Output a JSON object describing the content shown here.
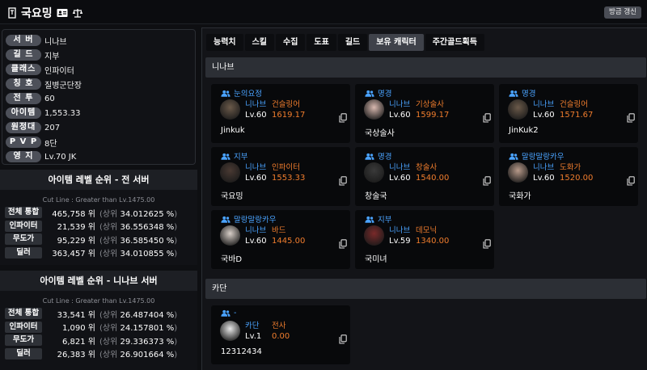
{
  "header": {
    "title": "국요밍",
    "refresh_label": "방금 갱신"
  },
  "info": [
    {
      "label": "서 버",
      "value": "니나브"
    },
    {
      "label": "길 드",
      "value": "지부"
    },
    {
      "label": "클래스",
      "value": "인파이터"
    },
    {
      "label": "칭 호",
      "value": "질병군단장"
    },
    {
      "label": "전 투",
      "value": "60"
    },
    {
      "label": "아이템",
      "value": "1,553.33"
    },
    {
      "label": "원정대",
      "value": "207"
    },
    {
      "label": "P V P",
      "value": "8단"
    },
    {
      "label": "영 지",
      "value": "Lv.70 JK"
    }
  ],
  "rank_all": {
    "title": "아이템 레벨 순위 - 전 서버",
    "cutline": "Cut Line : Greater than Lv.1475.00",
    "rows": [
      {
        "label": "전체 통합",
        "rank": "465,758 위",
        "pct": "34.012625 %"
      },
      {
        "label": "인파이터",
        "rank": "21,539 위",
        "pct": "36.556348 %"
      },
      {
        "label": "무도가",
        "rank": "95,229 위",
        "pct": "36.585450 %"
      },
      {
        "label": "딜러",
        "rank": "363,457 위",
        "pct": "34.010855 %"
      }
    ]
  },
  "rank_server": {
    "title": "아이템 레벨 순위 - 니나브 서버",
    "cutline": "Cut Line : Greater than Lv.1475.00",
    "rows": [
      {
        "label": "전체 통합",
        "rank": "33,541 위",
        "pct": "26.487404 %"
      },
      {
        "label": "인파이터",
        "rank": "1,090 위",
        "pct": "24.157801 %"
      },
      {
        "label": "무도가",
        "rank": "6,821 위",
        "pct": "29.336373 %"
      },
      {
        "label": "딜러",
        "rank": "26,383 위",
        "pct": "26.901664 %"
      }
    ]
  },
  "rank_labels": {
    "upper": "(상위",
    "close": ")"
  },
  "tabs": [
    "능력치",
    "스킬",
    "수집",
    "도표",
    "길드",
    "보유 캐릭터",
    "주간골드획득"
  ],
  "active_tab": "보유 캐릭터",
  "groups": [
    {
      "server": "니나브",
      "characters": [
        {
          "guild": "눈의요정",
          "server": "니나브",
          "class": "건슬링어",
          "level": "Lv.60",
          "ilvl": "1619.17",
          "name": "Jinkuk",
          "avatar_color": "#6b5a4a"
        },
        {
          "guild": "명경",
          "server": "니나브",
          "class": "기상술사",
          "level": "Lv.60",
          "ilvl": "1599.17",
          "name": "국상술사",
          "avatar_color": "#d9b9b0"
        },
        {
          "guild": "명경",
          "server": "니나브",
          "class": "건슬링어",
          "level": "Lv.60",
          "ilvl": "1571.67",
          "name": "JinKuk2",
          "avatar_color": "#6b5a4a"
        },
        {
          "guild": "지부",
          "server": "니나브",
          "class": "인파이터",
          "level": "Lv.60",
          "ilvl": "1553.33",
          "name": "국요밍",
          "avatar_color": "#4a3a33"
        },
        {
          "guild": "명경",
          "server": "니나브",
          "class": "창술사",
          "level": "Lv.60",
          "ilvl": "1540.00",
          "name": "창술국",
          "avatar_color": "#3a3a3a"
        },
        {
          "guild": "말랑말랑카우",
          "server": "니나브",
          "class": "도화가",
          "level": "Lv.60",
          "ilvl": "1520.00",
          "name": "국화가",
          "avatar_color": "#b89a8a"
        },
        {
          "guild": "말랑말랑카우",
          "server": "니나브",
          "class": "바드",
          "level": "Lv.60",
          "ilvl": "1445.00",
          "name": "국바D",
          "avatar_color": "#d8cfc8"
        },
        {
          "guild": "지부",
          "server": "니나브",
          "class": "데모닉",
          "level": "Lv.59",
          "ilvl": "1340.00",
          "name": "국미녀",
          "avatar_color": "#7a2a2a"
        }
      ]
    },
    {
      "server": "카단",
      "characters": [
        {
          "guild": "-",
          "server": "카단",
          "class": "전사",
          "level": "Lv.1",
          "ilvl": "0.00",
          "name": "12312434",
          "avatar_color": "#e8e8e8"
        }
      ]
    }
  ],
  "colors": {
    "accent": "#4aa3ff",
    "orange": "#f07d2d"
  }
}
